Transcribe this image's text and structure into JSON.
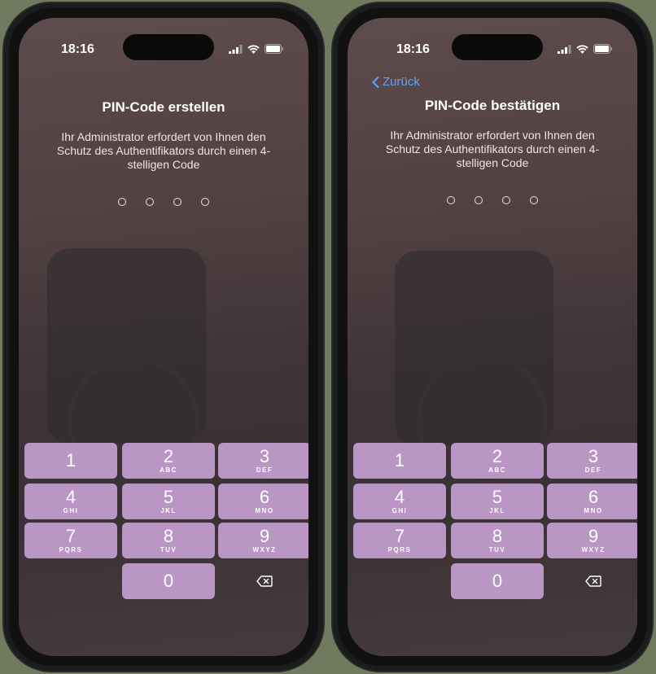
{
  "left_screen": {
    "time": "18:16",
    "title": "PIN-Code erstellen",
    "description": "Ihr Administrator erfordert von Ihnen den Schutz des Authentifikators durch einen 4-stelligen Code"
  },
  "right_screen": {
    "time": "18:16",
    "back_label": "Zurück",
    "title": "PIN-Code bestätigen",
    "description": "Ihr Administrator erfordert von Ihnen den Schutz des Authentifikators durch einen 4-stelligen Code"
  },
  "keypad": {
    "keys": [
      {
        "digit": "1",
        "letters": ""
      },
      {
        "digit": "2",
        "letters": "ABC"
      },
      {
        "digit": "3",
        "letters": "DEF"
      },
      {
        "digit": "4",
        "letters": "GHI"
      },
      {
        "digit": "5",
        "letters": "JKL"
      },
      {
        "digit": "6",
        "letters": "MNO"
      },
      {
        "digit": "7",
        "letters": "PQRS"
      },
      {
        "digit": "8",
        "letters": "TUV"
      },
      {
        "digit": "9",
        "letters": "WXYZ"
      },
      {
        "digit": "0",
        "letters": ""
      }
    ],
    "delete_icon": "backspace-icon"
  },
  "pin_length": 4,
  "colors": {
    "accent": "#5aa3ff",
    "key_background": "#b996c4"
  }
}
